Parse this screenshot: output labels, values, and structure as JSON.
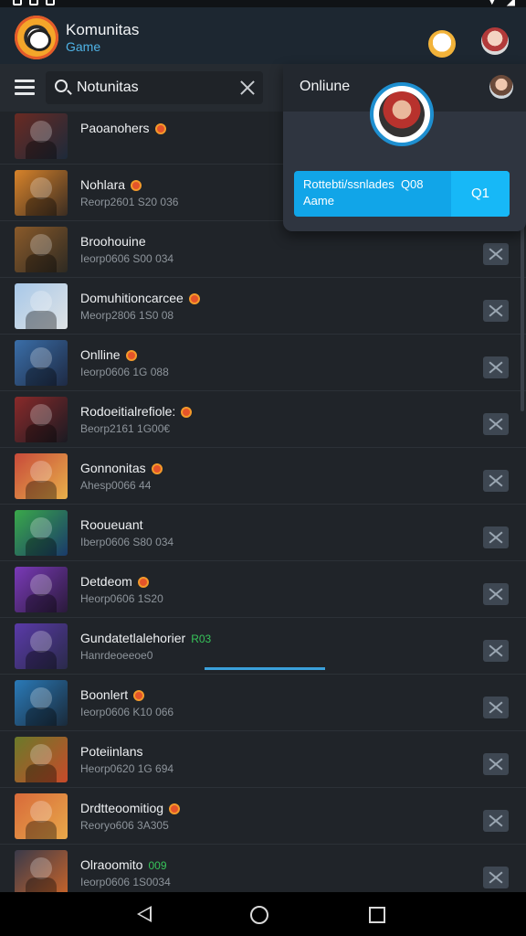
{
  "header": {
    "title": "Komunitas",
    "subtitle": "Game"
  },
  "toolbar": {
    "search_value": "Notunitas"
  },
  "online_panel": {
    "title": "Onliune",
    "card_text": "Rottebti/ssnlades  Q08\nAame",
    "button_label": "Q1"
  },
  "rows": [
    {
      "name": "Paoanohers",
      "meta": "",
      "badge": true,
      "tag": "",
      "colors": [
        "#6a2a22",
        "#1d2a3a"
      ]
    },
    {
      "name": "Nohlara",
      "meta": "Reorp2601 S20 036",
      "badge": true,
      "tag": "",
      "colors": [
        "#d8832a",
        "#3b2d22"
      ]
    },
    {
      "name": "Broohouine",
      "meta": "Ieorp0606 S00 034",
      "badge": false,
      "tag": "",
      "colors": [
        "#8a5a2a",
        "#2e2a22"
      ]
    },
    {
      "name": "Domuhitioncarcee",
      "meta": "Meorp2806 1S0 08",
      "badge": true,
      "tag": "",
      "colors": [
        "#a8c8e8",
        "#dfe3e6"
      ]
    },
    {
      "name": "Onlline",
      "meta": "Ieorp0606 1G 088",
      "badge": true,
      "tag": "",
      "colors": [
        "#3a6ea8",
        "#1e2a44"
      ]
    },
    {
      "name": "Rodoeitialrefiole:",
      "meta": "Beorp2161 1G00€",
      "badge": true,
      "tag": "",
      "colors": [
        "#8a2a2a",
        "#1a1a22"
      ]
    },
    {
      "name": "Gonnonitas",
      "meta": "Ahesp0066 44",
      "badge": true,
      "tag": "",
      "colors": [
        "#c84a3a",
        "#e8b04a"
      ]
    },
    {
      "name": "Rooueuant",
      "meta": "Iberp0606 S80 034",
      "badge": false,
      "tag": "",
      "colors": [
        "#3aa84a",
        "#1a3a6a"
      ]
    },
    {
      "name": "Detdeom",
      "meta": "Heorp0606 1S20",
      "badge": true,
      "tag": "",
      "colors": [
        "#7a3ab8",
        "#2a1a3a"
      ]
    },
    {
      "name": "Gundatetlalehorier",
      "meta": "Hanrdeoeeoe0",
      "badge": false,
      "tag": "R03",
      "colors": [
        "#5a3aa8",
        "#2a2a4a"
      ]
    },
    {
      "name": "Boonlert",
      "meta": "Ieorp0606 K10 066",
      "badge": true,
      "tag": "",
      "colors": [
        "#2a7ab8",
        "#1a2a3a"
      ]
    },
    {
      "name": "Poteiinlans",
      "meta": "Heorp0620 1G 694",
      "badge": false,
      "tag": "",
      "colors": [
        "#6a7a2a",
        "#c84a2a"
      ]
    },
    {
      "name": "Drdtteoomitiog",
      "meta": "Reoryo606 3A305",
      "badge": true,
      "tag": "",
      "colors": [
        "#d86a3a",
        "#e8a84a"
      ]
    },
    {
      "name": "Olraoomito",
      "meta": "Ieorp0606 1S0034",
      "badge": false,
      "tag": "009",
      "colors": [
        "#3a3a4a",
        "#c8642a"
      ]
    }
  ]
}
